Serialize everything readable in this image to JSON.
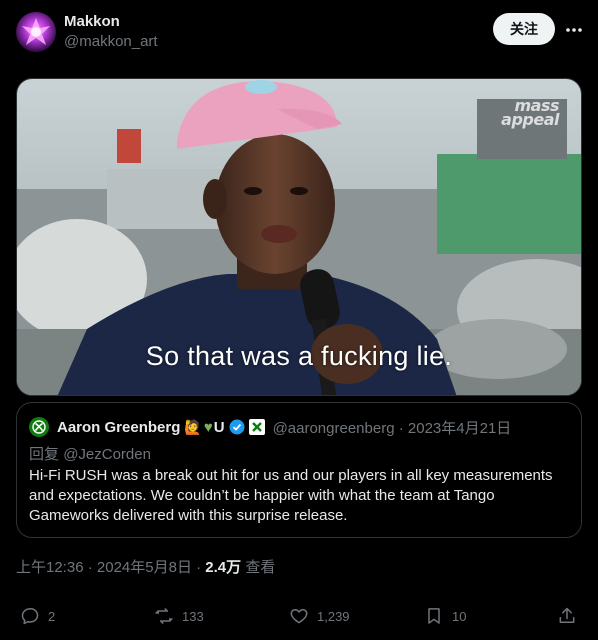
{
  "author": {
    "display_name": "Makkon",
    "handle": "@makkon_art",
    "avatar_icon": "purple-glowing-emblem"
  },
  "follow_label": "关注",
  "media": {
    "caption": "So that was a fucking lie.",
    "watermark_line1": "mass",
    "watermark_line2": "appeal"
  },
  "quoted_tweet": {
    "name": "Aaron Greenberg",
    "name_suffix": "U",
    "handle": "@aarongreenberg",
    "date": "2023年4月21日",
    "reply_prefix": "回复",
    "reply_to": "@JezCorden",
    "text": "Hi-Fi RUSH was a break out hit for us and our players in all key measurements and expectations. We couldn’t be happier with what the team at Tango Gameworks delivered with this surprise release."
  },
  "meta": {
    "time": "上午12:36",
    "date": "2024年5月8日",
    "views": "2.4万",
    "views_label": "查看"
  },
  "actions": {
    "replies": "2",
    "retweets": "133",
    "likes": "1,239",
    "bookmarks": "10"
  },
  "colors": {
    "background": "#000000",
    "text": "#e7e9ea",
    "muted": "#71767b",
    "border": "#2f3336",
    "verified": "#1d9bf0",
    "xbox_green": "#107c10"
  }
}
